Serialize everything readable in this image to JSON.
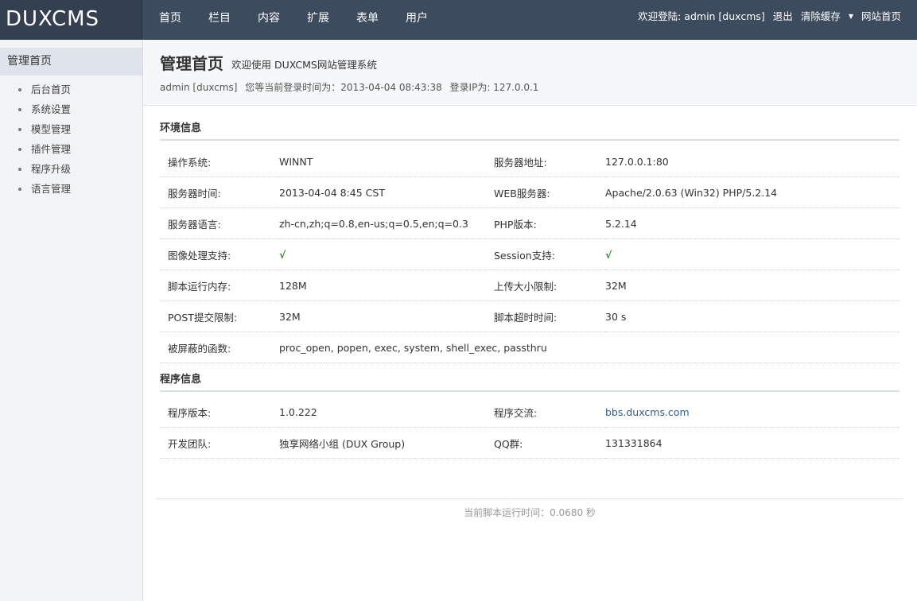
{
  "brand": {
    "logo_text": "DUXCMS"
  },
  "nav": [
    {
      "label": "首页"
    },
    {
      "label": "栏目"
    },
    {
      "label": "内容"
    },
    {
      "label": "扩展"
    },
    {
      "label": "表单"
    },
    {
      "label": "用户"
    }
  ],
  "user_bar": {
    "welcome": "欢迎登陆: admin [duxcms]",
    "logout": "退出",
    "clear_cache": "清除缓存",
    "site_home": "网站首页"
  },
  "sidebar": {
    "heading": "管理首页",
    "items": [
      {
        "label": "后台首页"
      },
      {
        "label": "系统设置"
      },
      {
        "label": "模型管理"
      },
      {
        "label": "插件管理"
      },
      {
        "label": "程序升级"
      },
      {
        "label": "语言管理"
      }
    ]
  },
  "page_header": {
    "title": "管理首页",
    "subtitle": "欢迎使用 DUXCMS网站管理系统",
    "user": "admin [duxcms]",
    "login_time": "您等当前登录时间为：2013-04-04 08:43:38",
    "login_ip": "登录IP为: 127.0.0.1"
  },
  "env": {
    "title": "环境信息",
    "rows": [
      {
        "k1": "操作系统:",
        "v1": "WINNT",
        "k2": "服务器地址:",
        "v2": "127.0.0.1:80"
      },
      {
        "k1": "服务器时间:",
        "v1": "2013-04-04 8:45 CST",
        "k2": "WEB服务器:",
        "v2": "Apache/2.0.63 (Win32) PHP/5.2.14"
      },
      {
        "k1": "服务器语言:",
        "v1": "zh-cn,zh;q=0.8,en-us;q=0.5,en;q=0.3",
        "k2": "PHP版本:",
        "v2": "5.2.14"
      },
      {
        "k1": "图像处理支持:",
        "v1": "√",
        "k2": "Session支持:",
        "v2": "√"
      },
      {
        "k1": "脚本运行内存:",
        "v1": "128M",
        "k2": "上传大小限制:",
        "v2": "32M"
      },
      {
        "k1": "POST提交限制:",
        "v1": "32M",
        "k2": "脚本超时时间:",
        "v2": "30 s"
      },
      {
        "k1": "被屏蔽的函数:",
        "v1": "proc_open, popen, exec, system, shell_exec, passthru"
      }
    ]
  },
  "program": {
    "title": "程序信息",
    "rows": [
      {
        "k1": "程序版本:",
        "v1": "1.0.222",
        "k2": "程序交流:",
        "v2": "bbs.duxcms.com"
      },
      {
        "k1": "开发团队:",
        "v1": "独享网络小组 (DUX Group)",
        "k2": "QQ群:",
        "v2": "131331864"
      }
    ]
  },
  "footer": {
    "runtime": "当前脚本运行时间：0.0680 秒"
  },
  "colors": {
    "topbar": "#3d4b5f",
    "link": "#2f5d8a",
    "check": "#2c8a2c"
  }
}
